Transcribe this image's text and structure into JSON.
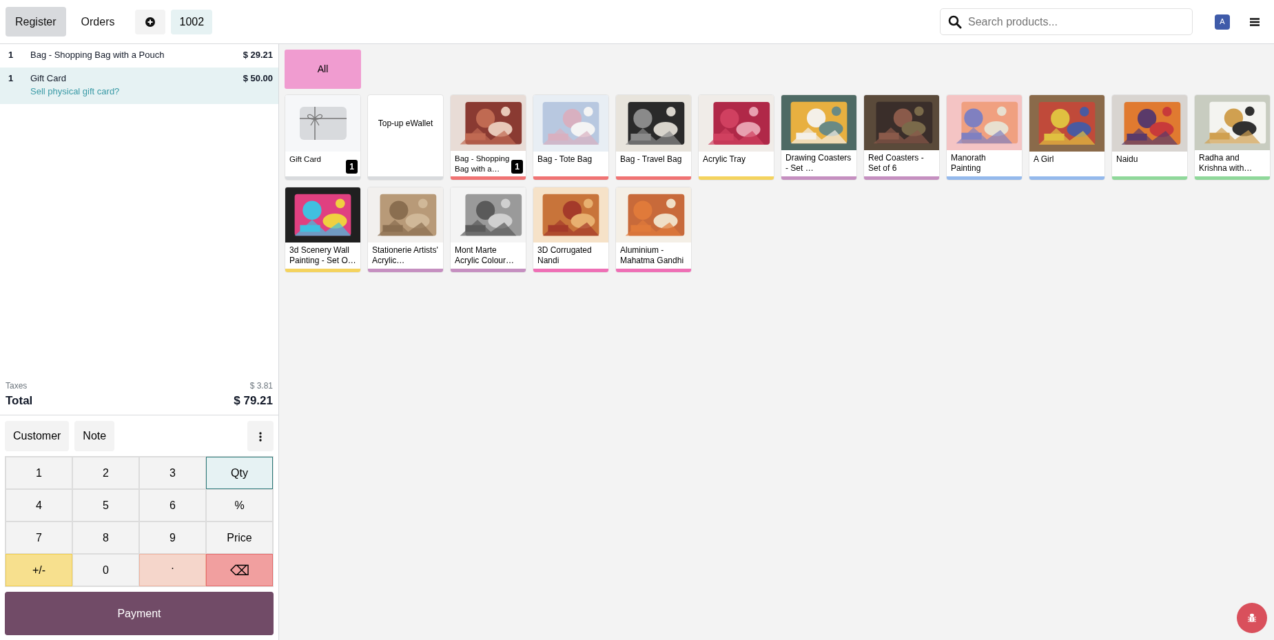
{
  "header": {
    "tabs": [
      {
        "label": "Register",
        "selected": true
      },
      {
        "label": "Orders",
        "selected": false
      }
    ],
    "order_tabs": [
      {
        "label": "1002",
        "selected": true
      }
    ],
    "search": {
      "placeholder": "Search products..."
    },
    "user": {
      "initial": "A"
    }
  },
  "order": {
    "lines": [
      {
        "qty": "1",
        "name": "Bag - Shopping Bag with a Pouch",
        "price": "$ 29.21",
        "selected": false
      },
      {
        "qty": "1",
        "name": "Gift Card",
        "price": "$ 50.00",
        "note": "Sell physical gift card?",
        "selected": true
      }
    ],
    "taxes_label": "Taxes",
    "taxes": "$ 3.81",
    "total_label": "Total",
    "total": "$ 79.21"
  },
  "actions": [
    "Customer",
    "Note"
  ],
  "numpad": [
    {
      "label": "1",
      "kind": "digit"
    },
    {
      "label": "2",
      "kind": "digit"
    },
    {
      "label": "3",
      "kind": "digit"
    },
    {
      "label": "Qty",
      "kind": "mode",
      "selected": true
    },
    {
      "label": "4",
      "kind": "digit"
    },
    {
      "label": "5",
      "kind": "digit"
    },
    {
      "label": "6",
      "kind": "digit"
    },
    {
      "label": "%",
      "kind": "mode",
      "selected": false
    },
    {
      "label": "7",
      "kind": "digit"
    },
    {
      "label": "8",
      "kind": "digit"
    },
    {
      "label": "9",
      "kind": "digit"
    },
    {
      "label": "Price",
      "kind": "mode",
      "selected": false
    },
    {
      "label": "+/-",
      "kind": "sign"
    },
    {
      "label": "0",
      "kind": "digit"
    },
    {
      "label": ".",
      "kind": "dot"
    },
    {
      "label": "⌫",
      "kind": "backspace"
    }
  ],
  "payment": "Payment",
  "categories": [
    {
      "label": "All",
      "selected": true
    }
  ],
  "products": [
    {
      "name": "Gift Card",
      "kind": "gift-card",
      "color": "#d8dadd",
      "qty": "1"
    },
    {
      "name": "Top-up eWallet",
      "kind": "label",
      "color": "#d8dadd"
    },
    {
      "name": "Bag - Shopping Bag with a…",
      "kind": "picture",
      "color": "#f07373",
      "qty": "1"
    },
    {
      "name": "Bag - Tote Bag",
      "kind": "picture",
      "color": "#f07373"
    },
    {
      "name": "Bag - Travel Bag",
      "kind": "picture",
      "color": "#f07373"
    },
    {
      "name": "Acrylic Tray",
      "kind": "picture",
      "color": "#f4d35e"
    },
    {
      "name": "Drawing Coasters - Set …",
      "kind": "picture",
      "color": "#c58fc0"
    },
    {
      "name": "Red Coasters - Set of 6",
      "kind": "picture",
      "color": "#c58fc0"
    },
    {
      "name": "Manorath Painting",
      "kind": "picture",
      "color": "#94b9ec"
    },
    {
      "name": "A Girl",
      "kind": "picture",
      "color": "#94b9ec"
    },
    {
      "name": "Naidu",
      "kind": "picture",
      "color": "#8fd89a"
    },
    {
      "name": "Radha and Krishna with…",
      "kind": "picture",
      "color": "#8fd89a"
    },
    {
      "name": "3d Scenery Wall Painting - Set O…",
      "kind": "picture",
      "color": "#f4d35e"
    },
    {
      "name": "Stationerie Artists' Acrylic…",
      "kind": "picture",
      "color": "#c58fc0"
    },
    {
      "name": "Mont Marte Acrylic Colour…",
      "kind": "picture",
      "color": "#c58fc0"
    },
    {
      "name": "3D Corrugated Nandi",
      "kind": "picture",
      "color": "#ee6fb5"
    },
    {
      "name": "Aluminium - Mahatma Gandhi",
      "kind": "picture",
      "color": "#ee6fb5"
    }
  ]
}
